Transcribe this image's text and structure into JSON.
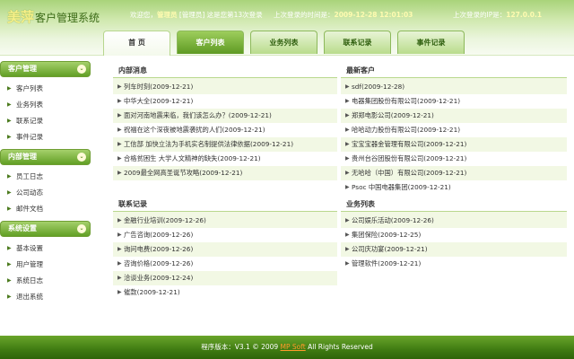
{
  "header": {
    "brand": "美萍",
    "title": "客户管理系统",
    "welcome_prefix": "欢迎您，",
    "username": "管理员",
    "role": "[管理员]",
    "login_text": "这是您第13次登录",
    "last_time_label": "上次登录的时间是：",
    "last_time": "2009-12-28 12:01:03",
    "last_ip_label": "上次登录的IP是：",
    "last_ip": "127.0.0.1"
  },
  "tabs": [
    {
      "label": "首 页"
    },
    {
      "label": "客户列表"
    },
    {
      "label": "业务列表"
    },
    {
      "label": "联系记录"
    },
    {
      "label": "事件记录"
    }
  ],
  "sidebar": {
    "sections": [
      {
        "title": "客户管理",
        "items": [
          "客户列表",
          "业务列表",
          "联系记录",
          "事件记录"
        ]
      },
      {
        "title": "内部管理",
        "items": [
          "员工日志",
          "公司动态",
          "邮件文档"
        ]
      },
      {
        "title": "系统设置",
        "items": [
          "基本设置",
          "用户管理",
          "系统日志",
          "退出系统"
        ]
      }
    ]
  },
  "panels": {
    "internal_news": {
      "title": "内部消息",
      "items": [
        "列车时刻(2009-12-21)",
        "中华大全(2009-12-21)",
        "面对河南地震来临，我们该怎么办？(2009-12-21)",
        "祝福在这个深夜被地震袭扰的人们(2009-12-21)",
        "工信部 加快立法为手机实名制提供法律依据(2009-12-21)",
        "合格贫困生 大学人文精神的缺失(2009-12-21)",
        "2009最全网高圣诞节攻略(2009-12-21)"
      ]
    },
    "latest_customers": {
      "title": "最新客户",
      "items": [
        "sdf(2009-12-28)",
        "电器集团股份有限公司(2009-12-21)",
        "郑郑电影公司(2009-12-21)",
        "哈哈动力股份有限公司(2009-12-21)",
        "宝宝宝器金管理有限公司(2009-12-21)",
        "贵州台谷团股份有限公司(2009-12-21)",
        "无哈哈（中国）有限公司(2009-12-21)",
        "Psoc 中国电器集团(2009-12-21)"
      ]
    },
    "contact_records": {
      "title": "联系记录",
      "items": [
        "金融行业培训(2009-12-26)",
        "广告咨询(2009-12-26)",
        "询问电费(2009-12-26)",
        "咨询价格(2009-12-26)",
        "洽谈业务(2009-12-24)",
        "催款(2009-12-21)"
      ]
    },
    "business_list": {
      "title": "业务列表",
      "items": [
        "公司娱乐活动(2009-12-26)",
        "集团保险(2009-12-25)",
        "公司庆功宴(2009-12-21)",
        "管理软件(2009-12-21)"
      ]
    }
  },
  "footer": {
    "prefix": "程序版本：V3.1 © 2009 ",
    "link": "MP Soft",
    "suffix": " All Rights Reserved"
  }
}
